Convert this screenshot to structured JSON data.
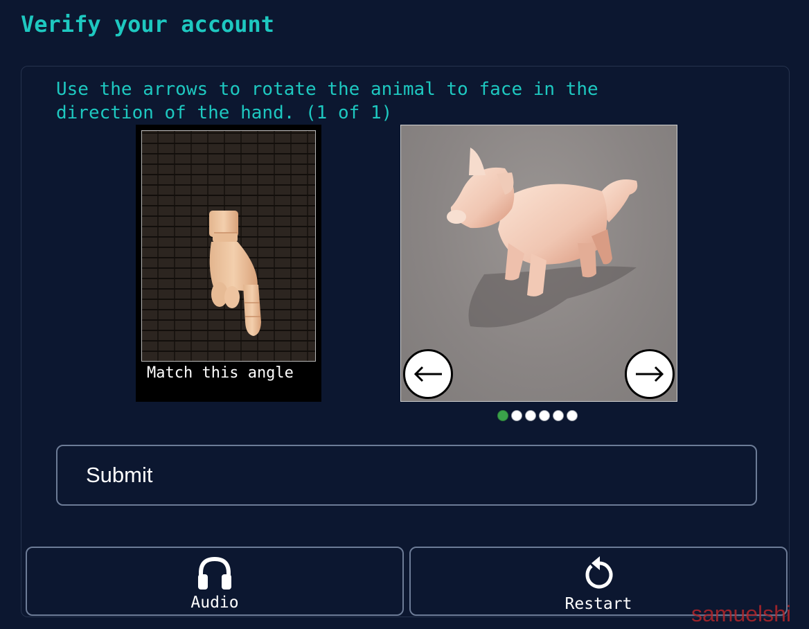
{
  "header": {
    "title": "Verify your account"
  },
  "challenge": {
    "instruction": "Use the arrows to rotate the animal to face in the direction of the hand. (1 of 1)",
    "hand_caption": "Match this angle",
    "animal": {
      "left_arrow_icon": "arrow-left-icon",
      "right_arrow_icon": "arrow-right-icon",
      "pager_total": 6,
      "pager_active": 1
    }
  },
  "actions": {
    "submit_label": "Submit",
    "audio_label": "Audio",
    "audio_icon": "headphones-icon",
    "restart_label": "Restart",
    "restart_icon": "restart-icon"
  },
  "colors": {
    "background": "#0c1730",
    "accent": "#1ec8c0",
    "button_border": "#6d7c97",
    "active_dot": "#3aa14a"
  },
  "watermark": "samuelshi"
}
